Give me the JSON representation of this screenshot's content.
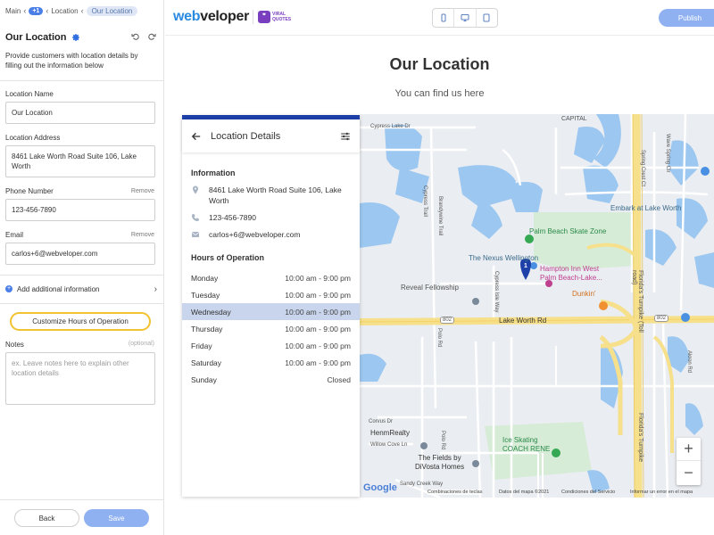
{
  "breadcrumb": {
    "main": "Main",
    "badge": "+1",
    "location": "Location",
    "current": "Our Location"
  },
  "panel": {
    "title": "Our Location",
    "description": "Provide customers with location details by filling out the information below"
  },
  "fields": {
    "location_name": {
      "label": "Location Name",
      "value": "Our Location"
    },
    "location_address": {
      "label": "Location Address",
      "value": "8461 Lake Worth Road Suite 106, Lake Worth"
    },
    "phone": {
      "label": "Phone Number",
      "remove": "Remove",
      "value": "123-456-7890"
    },
    "email": {
      "label": "Email",
      "remove": "Remove",
      "value": "carlos+6@webveloper.com"
    },
    "add_info": "Add additional information",
    "customize_hours": "Customize Hours of Operation",
    "notes": {
      "label": "Notes",
      "optional": "(optional)",
      "placeholder": "ex. Leave notes here to explain other location details"
    }
  },
  "footer": {
    "back": "Back",
    "save": "Save"
  },
  "topbar": {
    "logo_web": "web",
    "logo_rest": "veloper",
    "partner_line1": "VIRAL",
    "partner_line2": "QUOTES",
    "publish": "Publish"
  },
  "page": {
    "title": "Our Location",
    "subtitle": "You can find us here"
  },
  "card": {
    "title": "Location Details",
    "info_heading": "Information",
    "address": "8461 Lake Worth Road Suite 106, Lake Worth",
    "phone": "123-456-7890",
    "email": "carlos+6@webveloper.com",
    "hours_heading": "Hours of Operation",
    "hours": [
      {
        "day": "Monday",
        "time": "10:00 am - 9:00 pm"
      },
      {
        "day": "Tuesday",
        "time": "10:00 am - 9:00 pm"
      },
      {
        "day": "Wednesday",
        "time": "10:00 am - 9:00 pm"
      },
      {
        "day": "Thursday",
        "time": "10:00 am - 9:00 pm"
      },
      {
        "day": "Friday",
        "time": "10:00 am - 9:00 pm"
      },
      {
        "day": "Saturday",
        "time": "10:00 am - 9:00 pm"
      },
      {
        "day": "Sunday",
        "time": "Closed"
      }
    ]
  },
  "map": {
    "labels": {
      "capital": "CAPITAL",
      "cypress_lake": "Cypress Lake Dr",
      "spring_crest": "Spring Crest Ct",
      "wave_spring": "Wave Spring Cir",
      "embark": "Embark at Lake Worth",
      "cypress_trail": "Cypress Trail",
      "brandywine": "Brandywine Trail",
      "skate_zone": "Palm Beach Skate Zone",
      "nexus": "The Nexus Wellington",
      "hampton1": "Hampton Inn West",
      "hampton2": "Palm Beach-Lake...",
      "dunkin": "Dunkin'",
      "reveal": "Reveal Fellowship",
      "cypress_isle": "Cypress Isle Way",
      "lake_worth_rd": "Lake Worth Rd",
      "r802a": "802",
      "r802b": "802",
      "turnpike1": "Florida's Turnpike (Toll road)",
      "turnpike2": "Florida's Turnpike",
      "akron": "Akron Rd",
      "polo": "Polo Rd",
      "corvus": "Corvus Dr",
      "henmrealty": "HenmRealty",
      "willow": "Willow Cove Ln",
      "fields1": "The Fields by",
      "fields2": "DiVosta Homes",
      "ice1": "Ice Skating",
      "ice2": "COACH RENE",
      "sandy": "Sandy Creek Way",
      "combos": "Combinaciones de teclas",
      "mapdata": "Datos del mapa ©2021",
      "terms": "Condiciones del Servicio",
      "report": "Informar un error en el mapa",
      "google": "Google",
      "marker": "1"
    },
    "zoom_in": "+",
    "zoom_out": "−"
  }
}
